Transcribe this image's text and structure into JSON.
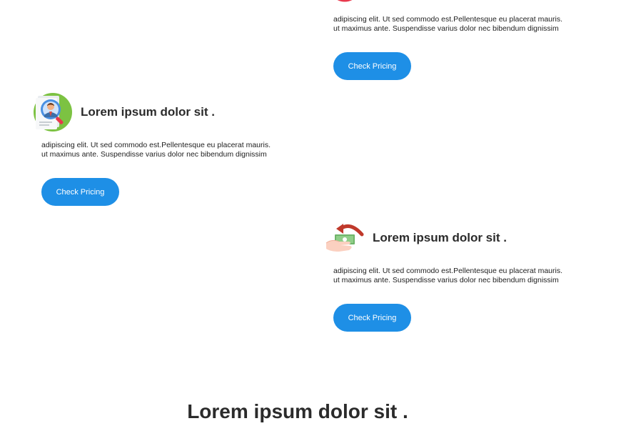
{
  "cards": [
    {
      "icon": "target-icon",
      "text_line1": "adipiscing elit. Ut sed commodo est.Pellentesque eu placerat mauris.",
      "text_line2": "ut maximus ante. Suspendisse varius dolor nec bibendum dignissim",
      "button_label": "Check Pricing"
    },
    {
      "icon": "candidate-search-icon",
      "title": "Lorem ipsum dolor sit .",
      "text_line1": "adipiscing elit. Ut sed commodo est.Pellentesque eu placerat mauris.",
      "text_line2": "ut maximus ante. Suspendisse varius dolor nec bibendum dignissim",
      "button_label": "Check Pricing"
    },
    {
      "icon": "money-back-icon",
      "title": "Lorem ipsum dolor sit .",
      "text_line1": "adipiscing elit. Ut sed commodo est.Pellentesque eu placerat mauris.",
      "text_line2": "ut maximus ante. Suspendisse varius dolor nec bibendum dignissim",
      "button_label": "Check Pricing"
    }
  ],
  "section": {
    "heading": "Lorem ipsum dolor sit ."
  },
  "colors": {
    "button": "#1e8fe6",
    "text": "#2b2b2b"
  }
}
